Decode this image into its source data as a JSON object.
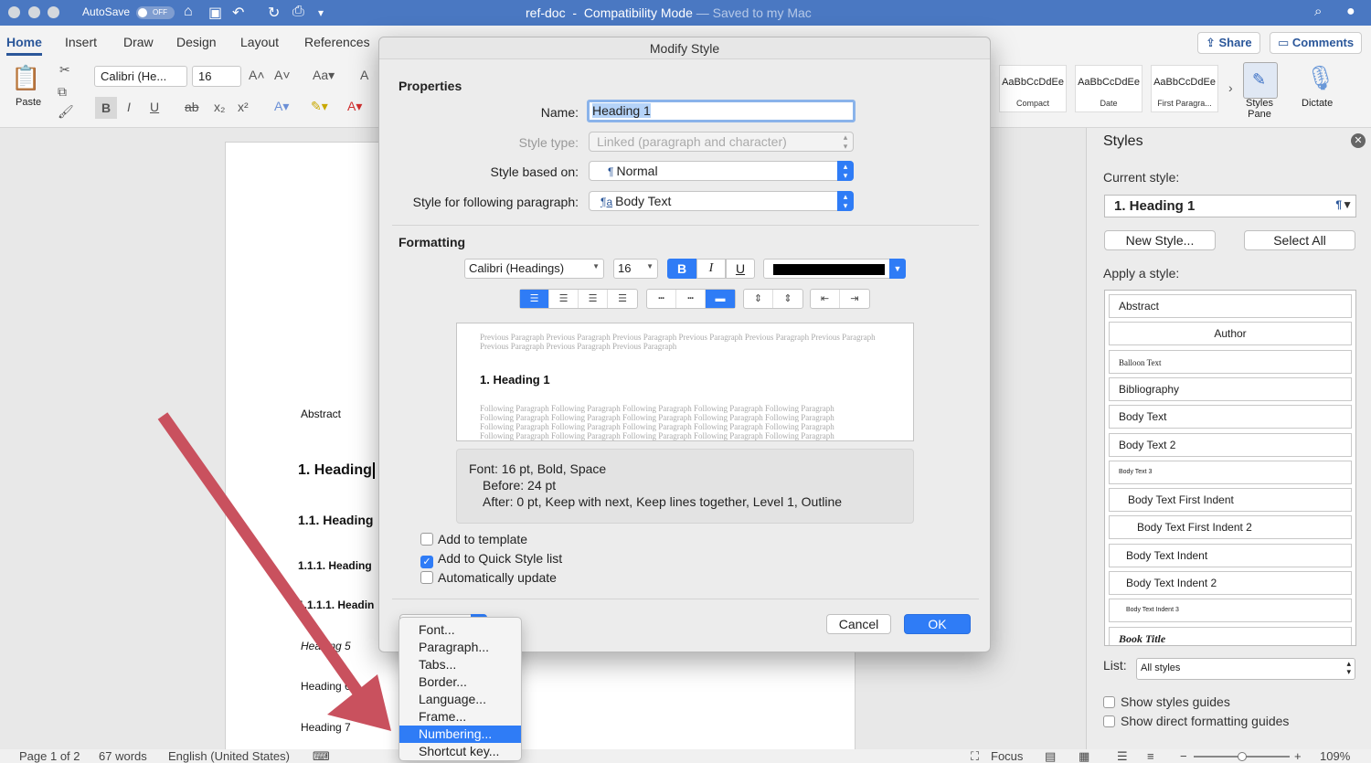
{
  "titlebar": {
    "autosave_label": "AutoSave",
    "autosave_state": "OFF",
    "doc_name": "ref-doc",
    "mode": "Compatibility Mode",
    "saved_note": "— Saved to my Mac"
  },
  "ribbon": {
    "tabs": [
      "Home",
      "Insert",
      "Draw",
      "Design",
      "Layout",
      "References"
    ],
    "share": "Share",
    "comments": "Comments",
    "paste": "Paste",
    "font_name": "Calibri (He...",
    "font_size": "16",
    "gallery": [
      {
        "sample": "AaBbCcDdEe",
        "name": "Compact"
      },
      {
        "sample": "AaBbCcDdEe",
        "name": "Date"
      },
      {
        "sample": "AaBbCcDdEe",
        "name": "First Paragra..."
      }
    ],
    "styles_pane_label": "Styles Pane",
    "dictate_label": "Dictate"
  },
  "document": {
    "lines": [
      {
        "text": "Abstract",
        "style": "normal"
      },
      {
        "text": "1.  Heading",
        "style": "h1"
      },
      {
        "text": "1.1.  Heading",
        "style": "h2"
      },
      {
        "text": "1.1.1.  Heading",
        "style": "h3"
      },
      {
        "text": "1.1.1.1.  Headin",
        "style": "h4"
      },
      {
        "text": "Heading 5",
        "style": "h5"
      },
      {
        "text": "Heading 6",
        "style": "h6"
      },
      {
        "text": "Heading 7",
        "style": "h7"
      }
    ]
  },
  "dialog": {
    "title": "Modify Style",
    "properties_label": "Properties",
    "name_label": "Name:",
    "name_value": "Heading 1",
    "style_type_label": "Style type:",
    "style_type_value": "Linked (paragraph and character)",
    "based_on_label": "Style based on:",
    "based_on_value": "Normal",
    "following_label": "Style for following paragraph:",
    "following_value": "Body Text",
    "formatting_label": "Formatting",
    "font_value": "Calibri (Headings)",
    "size_value": "16",
    "bold": "B",
    "italic": "I",
    "underline": "U",
    "preview": {
      "previous": "Previous Paragraph Previous Paragraph Previous Paragraph Previous Paragraph Previous Paragraph Previous Paragraph Previous Paragraph Previous Paragraph Previous Paragraph",
      "heading": "1.  Heading 1",
      "following_lines": [
        "Following Paragraph Following Paragraph Following Paragraph Following Paragraph Following Paragraph",
        "Following Paragraph Following Paragraph Following Paragraph Following Paragraph Following Paragraph",
        "Following Paragraph Following Paragraph Following Paragraph Following Paragraph Following Paragraph",
        "Following Paragraph Following Paragraph Following Paragraph Following Paragraph Following Paragraph"
      ]
    },
    "description": {
      "line1": "Font: 16 pt, Bold, Space",
      "line2": "Before:  24 pt",
      "line3": "After:  0 pt, Keep with next, Keep lines together, Level 1, Outline"
    },
    "add_to_template": "Add to template",
    "add_to_quick": "Add to Quick Style list",
    "auto_update": "Automatically update",
    "cancel": "Cancel",
    "ok": "OK"
  },
  "format_menu": {
    "items": [
      "Font...",
      "Paragraph...",
      "Tabs...",
      "Border...",
      "Language...",
      "Frame...",
      "Numbering...",
      "Shortcut key..."
    ],
    "highlighted": "Numbering..."
  },
  "styles_pane": {
    "title": "Styles",
    "current_label": "Current style:",
    "current_value": "1.  Heading 1",
    "new_style": "New Style...",
    "select_all": "Select All",
    "apply_label": "Apply a style:",
    "styles": [
      {
        "name": "Abstract",
        "align": "left",
        "size": 12,
        "weight": "normal",
        "style": "normal",
        "indent": 0
      },
      {
        "name": "Author",
        "align": "center",
        "size": 12,
        "weight": "normal",
        "style": "normal",
        "indent": 0
      },
      {
        "name": "Balloon Text",
        "align": "left",
        "size": 9,
        "weight": "normal",
        "style": "normal",
        "indent": 0,
        "serif": true
      },
      {
        "name": "Bibliography",
        "align": "left",
        "size": 12,
        "weight": "normal",
        "style": "normal",
        "indent": 0
      },
      {
        "name": "Body Text",
        "align": "left",
        "size": 12,
        "weight": "normal",
        "style": "normal",
        "indent": 0
      },
      {
        "name": "Body Text 2",
        "align": "left",
        "size": 12,
        "weight": "normal",
        "style": "normal",
        "indent": 0
      },
      {
        "name": "Body Text 3",
        "align": "left",
        "size": 7,
        "weight": "normal",
        "style": "normal",
        "indent": 0
      },
      {
        "name": "Body Text First Indent",
        "align": "left",
        "size": 12,
        "weight": "normal",
        "style": "normal",
        "indent": 10
      },
      {
        "name": "Body Text First Indent 2",
        "align": "left",
        "size": 12,
        "weight": "normal",
        "style": "normal",
        "indent": 20
      },
      {
        "name": "Body Text Indent",
        "align": "left",
        "size": 12,
        "weight": "normal",
        "style": "normal",
        "indent": 8
      },
      {
        "name": "Body Text Indent 2",
        "align": "left",
        "size": 12,
        "weight": "normal",
        "style": "normal",
        "indent": 8
      },
      {
        "name": "Body Text Indent 3",
        "align": "left",
        "size": 7,
        "weight": "normal",
        "style": "normal",
        "indent": 8
      },
      {
        "name": "Book Title",
        "align": "left",
        "size": 12,
        "weight": "bold",
        "style": "italic",
        "indent": 0,
        "serif": true
      }
    ],
    "list_label": "List:",
    "list_value": "All styles",
    "show_guides": "Show styles guides",
    "show_direct": "Show direct formatting guides"
  },
  "statusbar": {
    "page": "Page 1 of 2",
    "words": "67 words",
    "language": "English (United States)",
    "focus": "Focus",
    "zoom": "109%"
  },
  "colors": {
    "accent": "#2f7cf6",
    "titlebar": "#4a78c2",
    "arrow": "#c9515e"
  }
}
